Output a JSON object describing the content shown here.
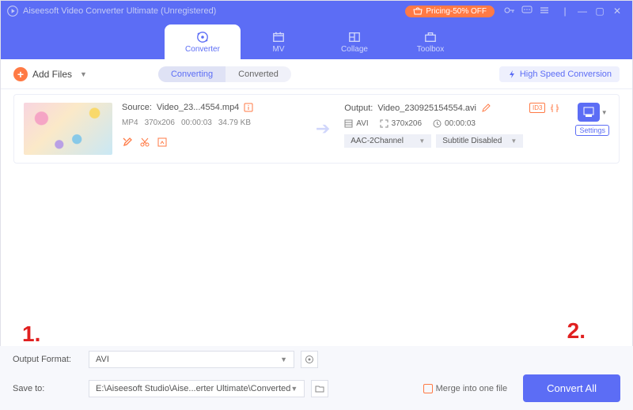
{
  "title": "Aiseesoft Video Converter Ultimate (Unregistered)",
  "pricing": "Pricing-50% OFF",
  "tabs": {
    "converter": "Converter",
    "mv": "MV",
    "collage": "Collage",
    "toolbox": "Toolbox"
  },
  "toolbar": {
    "add_files": "Add Files",
    "converting": "Converting",
    "converted": "Converted",
    "high_speed": "High Speed Conversion"
  },
  "file": {
    "source_label": "Source:",
    "source_name": "Video_23...4554.mp4",
    "output_label": "Output:",
    "output_name": "Video_230925154554.avi",
    "src_fmt": "MP4",
    "src_res": "370x206",
    "src_dur": "00:00:03",
    "src_size": "34.79 KB",
    "out_fmt": "AVI",
    "out_res": "370x206",
    "out_dur": "00:00:03",
    "audio_sel": "AAC-2Channel",
    "subtitle_sel": "Subtitle Disabled",
    "settings": "Settings",
    "id3": "ID3"
  },
  "bottom": {
    "output_format_label": "Output Format:",
    "output_format_value": "AVI",
    "save_to_label": "Save to:",
    "save_to_value": "E:\\Aiseesoft Studio\\Aise...erter Ultimate\\Converted",
    "merge": "Merge into one file",
    "convert_all": "Convert All"
  },
  "annot": {
    "one": "1.",
    "two": "2."
  }
}
